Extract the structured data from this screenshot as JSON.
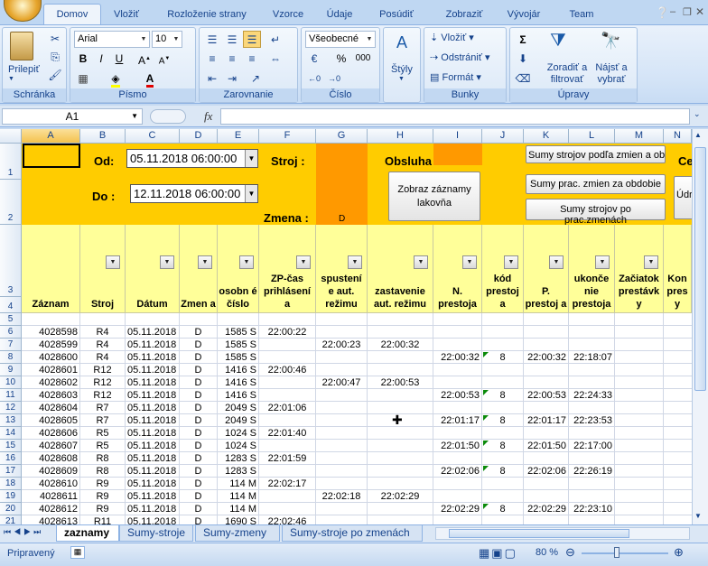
{
  "ribbon_tabs": [
    "Domov",
    "Vložiť",
    "Rozloženie strany",
    "Vzorce",
    "Údaje",
    "Posúdiť",
    "Zobraziť",
    "Vývojár",
    "Team"
  ],
  "ribbon": {
    "clipboard": {
      "paste": "Prilepiť",
      "label": "Schránka"
    },
    "font": {
      "name": "Arial",
      "size": "10",
      "label": "Písmo",
      "bold": "B",
      "italic": "I",
      "underline": "U"
    },
    "alignment": {
      "label": "Zarovnanie"
    },
    "number": {
      "format": "Všeobecné",
      "label": "Číslo",
      "percent": "%",
      "thousands": "000"
    },
    "styles": {
      "label": "Štýly"
    },
    "cells": {
      "insert": "Vložiť",
      "delete": "Odstrániť",
      "format": "Formát",
      "label": "Bunky"
    },
    "editing": {
      "sort_filter": "Zoradiť a filtrovať",
      "find_select": "Nájsť a vybrať",
      "label": "Úpravy"
    }
  },
  "formula_bar": {
    "name_box": "A1",
    "fx": "fx",
    "value": ""
  },
  "columns": [
    "A",
    "B",
    "C",
    "D",
    "E",
    "F",
    "G",
    "H",
    "I",
    "J",
    "K",
    "L",
    "M",
    "N"
  ],
  "top_panel": {
    "od_label": "Od:",
    "od_value": "05.11.2018 06:00:00",
    "do_label": "Do :",
    "do_value": "12.11.2018 06:00:00",
    "stroj_label": "Stroj :",
    "zmena_label": "Zmena :",
    "zmena_value": "D",
    "obsluha_label": "Obsluha",
    "btn_zobraz": "Zobraz záznamy lakovňa",
    "btn_sumy_zmien": "Sumy strojov podľa zmien a obd",
    "btn_prac_zmien": "Sumy prac. zmien za obdobie",
    "btn_prac_zmenach": "Sumy strojov po prac.zmenách",
    "btn_ce": "Ce",
    "btn_ud": "Údr"
  },
  "header_labels": [
    "Záznam",
    "Stroj",
    "Dátum",
    "Zmen a",
    "osobn é číslo",
    "ZP-čas prihlásení a",
    "spustení e aut. režimu",
    "zastavenie aut. režimu",
    "N. prestoja",
    "kód prestoj a",
    "P. prestoj a",
    "ukonče nie prestoja",
    "Začiatok prestávk y",
    "Kon pres y"
  ],
  "rows": [
    {
      "n": "5",
      "c": [
        "",
        "",
        "",
        "",
        "",
        "",
        "",
        "",
        "",
        "",
        "",
        "",
        ""
      ]
    },
    {
      "n": "6",
      "c": [
        "4028598",
        "R4",
        "05.11.2018",
        "D",
        "1585 S",
        "22:00:22",
        "",
        "",
        "",
        "",
        "",
        "",
        ""
      ]
    },
    {
      "n": "7",
      "c": [
        "4028599",
        "R4",
        "05.11.2018",
        "D",
        "1585 S",
        "",
        "22:00:23",
        "22:00:32",
        "",
        "",
        "",
        "",
        ""
      ]
    },
    {
      "n": "8",
      "c": [
        "4028600",
        "R4",
        "05.11.2018",
        "D",
        "1585 S",
        "",
        "",
        "",
        "22:00:32",
        "8",
        "22:00:32",
        "22:18:07",
        ""
      ]
    },
    {
      "n": "9",
      "c": [
        "4028601",
        "R12",
        "05.11.2018",
        "D",
        "1416 S",
        "22:00:46",
        "",
        "",
        "",
        "",
        "",
        "",
        ""
      ]
    },
    {
      "n": "10",
      "c": [
        "4028602",
        "R12",
        "05.11.2018",
        "D",
        "1416 S",
        "",
        "22:00:47",
        "22:00:53",
        "",
        "",
        "",
        "",
        ""
      ]
    },
    {
      "n": "11",
      "c": [
        "4028603",
        "R12",
        "05.11.2018",
        "D",
        "1416 S",
        "",
        "",
        "",
        "22:00:53",
        "8",
        "22:00:53",
        "22:24:33",
        ""
      ]
    },
    {
      "n": "12",
      "c": [
        "4028604",
        "R7",
        "05.11.2018",
        "D",
        "2049 S",
        "22:01:06",
        "",
        "",
        "",
        "",
        "",
        "",
        ""
      ]
    },
    {
      "n": "13",
      "c": [
        "4028605",
        "R7",
        "05.11.2018",
        "D",
        "2049 S",
        "",
        "",
        "",
        "22:01:17",
        "8",
        "22:01:17",
        "22:23:53",
        ""
      ]
    },
    {
      "n": "14",
      "c": [
        "4028606",
        "R5",
        "05.11.2018",
        "D",
        "1024 S",
        "22:01:40",
        "",
        "",
        "",
        "",
        "",
        "",
        ""
      ]
    },
    {
      "n": "15",
      "c": [
        "4028607",
        "R5",
        "05.11.2018",
        "D",
        "1024 S",
        "",
        "",
        "",
        "22:01:50",
        "8",
        "22:01:50",
        "22:17:00",
        ""
      ]
    },
    {
      "n": "16",
      "c": [
        "4028608",
        "R8",
        "05.11.2018",
        "D",
        "1283 S",
        "22:01:59",
        "",
        "",
        "",
        "",
        "",
        "",
        ""
      ]
    },
    {
      "n": "17",
      "c": [
        "4028609",
        "R8",
        "05.11.2018",
        "D",
        "1283 S",
        "",
        "",
        "",
        "22:02:06",
        "8",
        "22:02:06",
        "22:26:19",
        ""
      ]
    },
    {
      "n": "18",
      "c": [
        "4028610",
        "R9",
        "05.11.2018",
        "D",
        "114 M",
        "22:02:17",
        "",
        "",
        "",
        "",
        "",
        "",
        ""
      ]
    },
    {
      "n": "19",
      "c": [
        "4028611",
        "R9",
        "05.11.2018",
        "D",
        "114 M",
        "",
        "22:02:18",
        "22:02:29",
        "",
        "",
        "",
        "",
        ""
      ]
    },
    {
      "n": "20",
      "c": [
        "4028612",
        "R9",
        "05.11.2018",
        "D",
        "114 M",
        "",
        "",
        "",
        "22:02:29",
        "8",
        "22:02:29",
        "22:23:10",
        ""
      ]
    },
    {
      "n": "21",
      "c": [
        "4028613",
        "R11",
        "05.11.2018",
        "D",
        "1690 S",
        "22:02:46",
        "",
        "",
        "",
        "",
        "",
        "",
        ""
      ]
    }
  ],
  "sheet_tabs": [
    "zaznamy",
    "Sumy-stroje",
    "Sumy-zmeny",
    "Sumy-stroje po zmenách"
  ],
  "status": {
    "ready": "Pripravený",
    "zoom": "80 %"
  }
}
